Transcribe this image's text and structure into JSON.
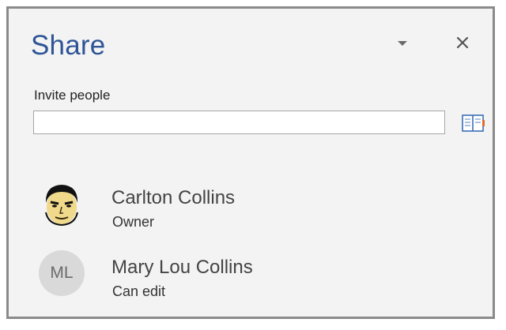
{
  "header": {
    "title": "Share",
    "dropdown_icon": "chevron-down-icon",
    "close_icon": "close-icon"
  },
  "invite": {
    "label": "Invite people",
    "value": "",
    "placeholder": "",
    "address_book_icon": "address-book-icon"
  },
  "people": [
    {
      "name": "Carlton Collins",
      "role": "Owner",
      "avatar": "photo"
    },
    {
      "name": "Mary Lou Collins",
      "role": "Can edit",
      "avatar_initials": "ML"
    }
  ],
  "colors": {
    "title": "#2f5597",
    "pane_background": "#f3f3f3",
    "initials_avatar_background": "#d9d9d9"
  }
}
